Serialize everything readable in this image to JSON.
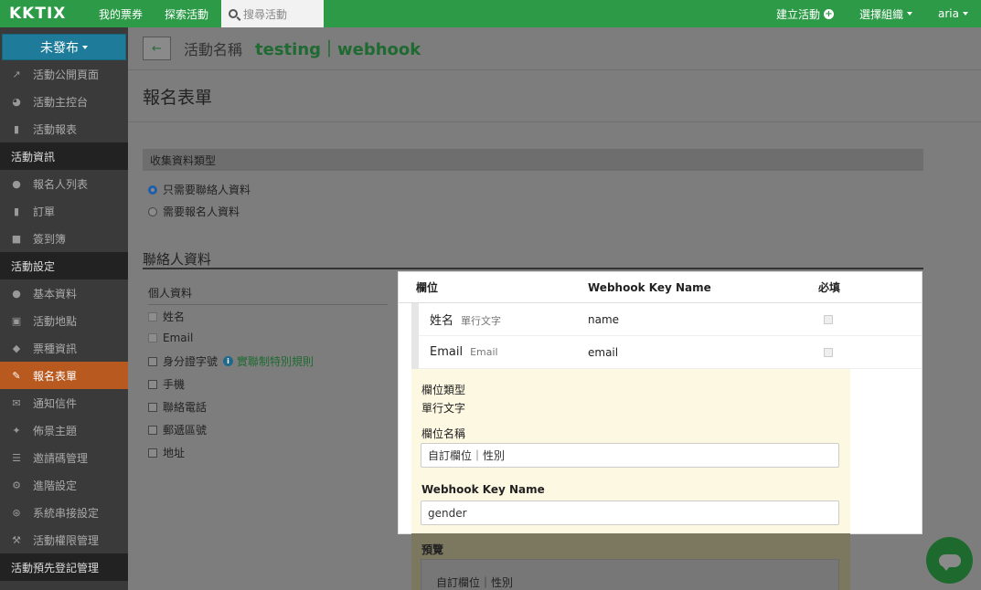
{
  "topnav": {
    "logo": "KKTIX",
    "links": [
      "我的票券",
      "探索活動"
    ],
    "search_placeholder": "搜尋活動",
    "create_event": "建立活動",
    "select_org": "選擇組織",
    "user": "aria"
  },
  "sidebar": {
    "status_button": "未發布",
    "items": [
      {
        "label": "活動公開頁面",
        "icon": "external-link-icon",
        "type": "item"
      },
      {
        "label": "活動主控台",
        "icon": "dashboard-icon",
        "type": "item"
      },
      {
        "label": "活動報表",
        "icon": "file-icon",
        "type": "item"
      },
      {
        "label": "活動資訊",
        "type": "head"
      },
      {
        "label": "報名人列表",
        "icon": "users-icon",
        "type": "item"
      },
      {
        "label": "訂單",
        "icon": "file-icon",
        "type": "item"
      },
      {
        "label": "簽到簿",
        "icon": "book-icon",
        "type": "item"
      },
      {
        "label": "活動設定",
        "type": "head"
      },
      {
        "label": "基本資料",
        "icon": "info-icon",
        "type": "item"
      },
      {
        "label": "活動地點",
        "icon": "image-icon",
        "type": "item"
      },
      {
        "label": "票種資訊",
        "icon": "tags-icon",
        "type": "item"
      },
      {
        "label": "報名表單",
        "icon": "edit-icon",
        "type": "item",
        "active": true
      },
      {
        "label": "通知信件",
        "icon": "envelope-icon",
        "type": "item"
      },
      {
        "label": "佈景主題",
        "icon": "magic-icon",
        "type": "item"
      },
      {
        "label": "邀請碼管理",
        "icon": "barcode-icon",
        "type": "item"
      },
      {
        "label": "進階設定",
        "icon": "gear-icon",
        "type": "item"
      },
      {
        "label": "系統串接設定",
        "icon": "sitemap-icon",
        "type": "item"
      },
      {
        "label": "活動權限管理",
        "icon": "wrench-icon",
        "type": "item"
      },
      {
        "label": "活動預先登記管理",
        "type": "head"
      }
    ]
  },
  "main": {
    "event_label": "活動名稱",
    "event_name": "testing｜webhook",
    "page_title": "報名表單",
    "collect_type_title": "收集資料類型",
    "radio_options": [
      "只需要聯絡人資料",
      "需要報名人資料"
    ],
    "contact_title": "聯絡人資料",
    "personal_title": "個人資料",
    "fields": [
      {
        "label": "姓名",
        "checked": true
      },
      {
        "label": "Email",
        "checked": true
      },
      {
        "label": "身分證字號",
        "checked": false,
        "link": "實聯制特別規則"
      },
      {
        "label": "手機",
        "checked": false
      },
      {
        "label": "聯絡電話",
        "checked": false
      },
      {
        "label": "郵遞區號",
        "checked": false
      },
      {
        "label": "地址",
        "checked": false
      }
    ]
  },
  "popup": {
    "col_field": "欄位",
    "col_key": "Webhook Key Name",
    "col_required": "必填",
    "rows": [
      {
        "name": "姓名",
        "type": "單行文字",
        "key": "name"
      },
      {
        "name": "Email",
        "type": "Email",
        "key": "email"
      }
    ],
    "editor": {
      "type_label": "欄位類型",
      "type_value": "單行文字",
      "name_label": "欄位名稱",
      "name_value": "自訂欄位｜性別",
      "key_label": "Webhook Key Name",
      "key_value": "gender",
      "preview_label": "預覽",
      "preview_value": "自訂欄位｜性別"
    }
  }
}
